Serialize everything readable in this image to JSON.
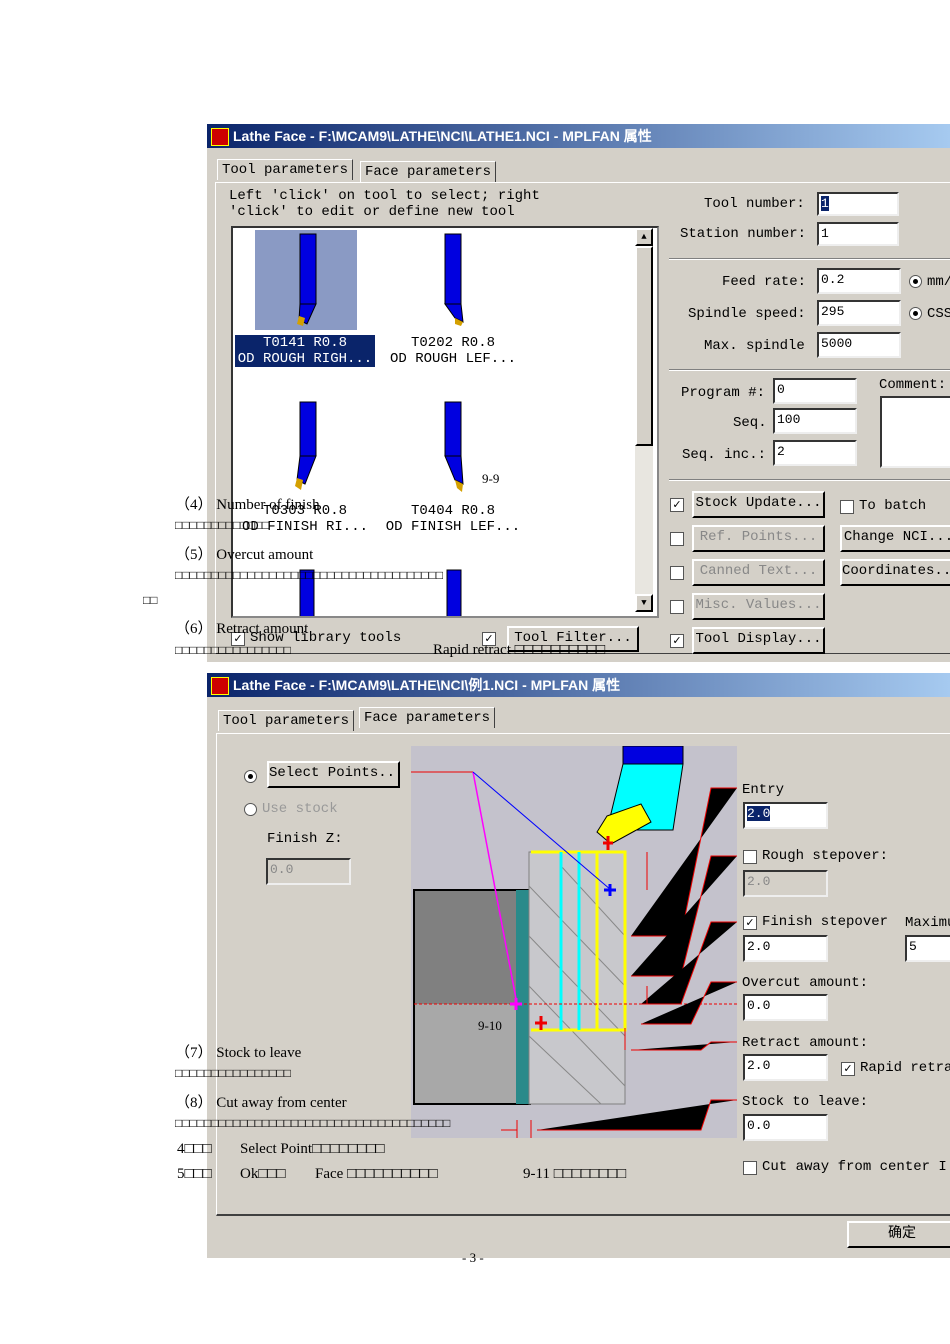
{
  "dialog1": {
    "title": "Lathe Face - F:\\MCAM9\\LATHE\\NCI\\LATHE1.NCI - MPLFAN 属性",
    "tabs": [
      "Tool parameters",
      "Face parameters"
    ],
    "hint_line1": "Left 'click' on tool to select; right",
    "hint_line2": "'click' to edit or define new tool",
    "tools": [
      {
        "num": "T0141 R0.8",
        "name": "OD ROUGH RIGH..."
      },
      {
        "num": "T0202 R0.8",
        "name": "OD ROUGH LEF..."
      },
      {
        "num": "T0303 R0.8",
        "name": "OD FINISH RI..."
      },
      {
        "num": "T0404 R0.8",
        "name": "OD FINISH LEF..."
      }
    ],
    "show_library_tools": "Show library tools",
    "tool_filter": "Tool Filter...",
    "tool_number_label": "Tool number:",
    "tool_number": "1",
    "station_number_label": "Station number:",
    "station_number": "1",
    "feed_rate_label": "Feed rate:",
    "feed_rate": "0.2",
    "feed_unit": "mm/",
    "spindle_speed_label": "Spindle speed:",
    "spindle_speed": "295",
    "spindle_unit": "CSS",
    "max_spindle_label": "Max. spindle",
    "max_spindle": "5000",
    "program_label": "Program #:",
    "program": "0",
    "seq_label": "Seq.",
    "seq": "100",
    "seq_inc_label": "Seq. inc.:",
    "seq_inc": "2",
    "comment_label": "Comment:",
    "stock_update": "Stock Update...",
    "to_batch": "To batch",
    "ref_points": "Ref. Points...",
    "change_nci": "Change NCI...",
    "canned_text": "Canned Text...",
    "coordinates": "Coordinates...",
    "misc_values": "Misc. Values...",
    "tool_display": "Tool Display..."
  },
  "dialog2": {
    "title": "Lathe Face - F:\\MCAM9\\LATHE\\NCI\\例1.NCI - MPLFAN 属性",
    "tabs": [
      "Tool parameters",
      "Face parameters"
    ],
    "select_points": "Select Points...",
    "use_stock": "Use stock",
    "finish_z_label": "Finish Z:",
    "finish_z": "0.0",
    "entry_label": "Entry",
    "entry": "2.0",
    "rough_stepover_label": "Rough stepover:",
    "rough_stepover": "2.0",
    "finish_stepover_label": "Finish stepover",
    "finish_stepover": "2.0",
    "maximum_label": "Maximu",
    "maximum": "5",
    "overcut_label": "Overcut amount:",
    "overcut": "0.0",
    "retract_label": "Retract amount:",
    "retract": "2.0",
    "rapid_retract": "Rapid retra",
    "stock_leave_label": "Stock to leave:",
    "stock_leave": "0.0",
    "cut_away": "Cut away from center I",
    "ok": "确定"
  },
  "overlay": {
    "fig_9_9": "9-9",
    "fig_9_10": "9-10",
    "item4": "（4）  Number of finish",
    "item4_desc": "□□□□□□□□□□□□□",
    "item5": "（5）  Overcut amount",
    "item5_desc": "□□□□□□□□□□□□□□□□□□□□□□□□□□□□□□□□□□□□□",
    "stray": "□□",
    "item6": "（6）  Retract amount",
    "item6_desc": "□□□□□□□□□□□□□□□□",
    "rapid_retract": "Rapid retract □□□□□□□□□□",
    "item7": "（7）  Stock to leave",
    "item7_desc": "□□□□□□□□□□□□□□□□",
    "item8": "（8）  Cut away from center",
    "item8_desc": "□□□□□□□□□□□□□□□□□□□□□□□□□□□□□□□□□□□□□□",
    "step4_num": "4□□□",
    "step4": "Select Point□□□□□□□□",
    "step5_num": "5□□□",
    "step5_a": "Ok□□□",
    "step5_b": "Face □□□□□□□□□□",
    "step5_c": "9-11 □□□□□□□□",
    "page_num": "- 3 -"
  }
}
